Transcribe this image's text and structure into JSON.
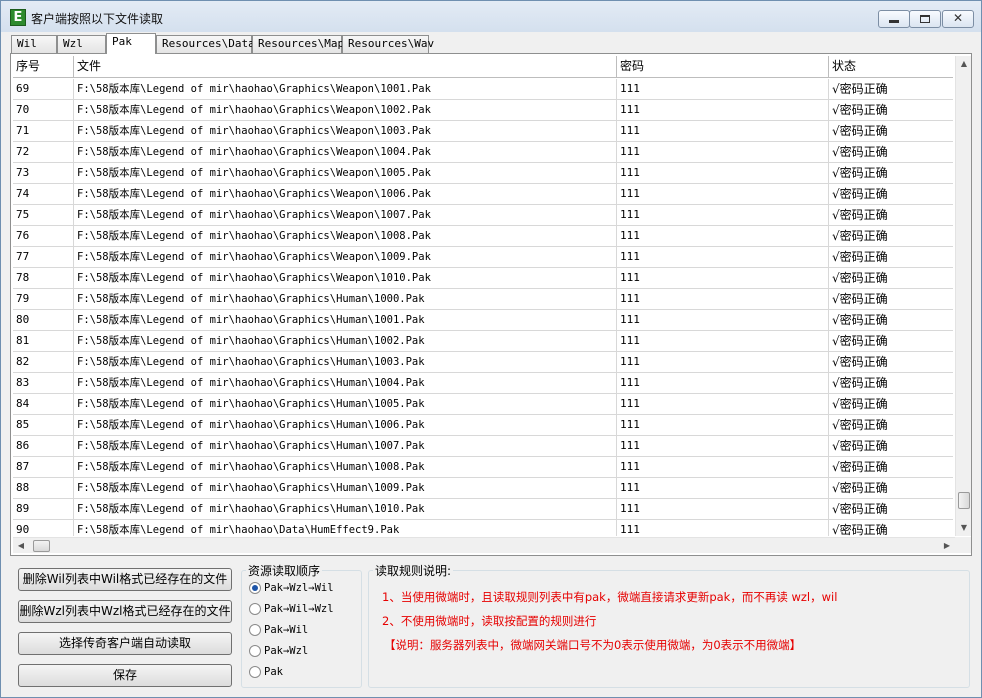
{
  "window": {
    "title": "客户端按照以下文件读取",
    "app_icon_letter": "E"
  },
  "tabs": [
    {
      "label": "Wil",
      "active": false
    },
    {
      "label": "Wzl",
      "active": false
    },
    {
      "label": "Pak",
      "active": true
    },
    {
      "label": "Resources\\Data",
      "active": false
    },
    {
      "label": "Resources\\Map",
      "active": false
    },
    {
      "label": "Resources\\Wav",
      "active": false
    }
  ],
  "table": {
    "columns": [
      "序号",
      "文件",
      "密码",
      "状态"
    ],
    "rows": [
      [
        "69",
        "F:\\58版本库\\Legend of mir\\haohao\\Graphics\\Weapon\\1001.Pak",
        "111",
        "√密码正确"
      ],
      [
        "70",
        "F:\\58版本库\\Legend of mir\\haohao\\Graphics\\Weapon\\1002.Pak",
        "111",
        "√密码正确"
      ],
      [
        "71",
        "F:\\58版本库\\Legend of mir\\haohao\\Graphics\\Weapon\\1003.Pak",
        "111",
        "√密码正确"
      ],
      [
        "72",
        "F:\\58版本库\\Legend of mir\\haohao\\Graphics\\Weapon\\1004.Pak",
        "111",
        "√密码正确"
      ],
      [
        "73",
        "F:\\58版本库\\Legend of mir\\haohao\\Graphics\\Weapon\\1005.Pak",
        "111",
        "√密码正确"
      ],
      [
        "74",
        "F:\\58版本库\\Legend of mir\\haohao\\Graphics\\Weapon\\1006.Pak",
        "111",
        "√密码正确"
      ],
      [
        "75",
        "F:\\58版本库\\Legend of mir\\haohao\\Graphics\\Weapon\\1007.Pak",
        "111",
        "√密码正确"
      ],
      [
        "76",
        "F:\\58版本库\\Legend of mir\\haohao\\Graphics\\Weapon\\1008.Pak",
        "111",
        "√密码正确"
      ],
      [
        "77",
        "F:\\58版本库\\Legend of mir\\haohao\\Graphics\\Weapon\\1009.Pak",
        "111",
        "√密码正确"
      ],
      [
        "78",
        "F:\\58版本库\\Legend of mir\\haohao\\Graphics\\Weapon\\1010.Pak",
        "111",
        "√密码正确"
      ],
      [
        "79",
        "F:\\58版本库\\Legend of mir\\haohao\\Graphics\\Human\\1000.Pak",
        "111",
        "√密码正确"
      ],
      [
        "80",
        "F:\\58版本库\\Legend of mir\\haohao\\Graphics\\Human\\1001.Pak",
        "111",
        "√密码正确"
      ],
      [
        "81",
        "F:\\58版本库\\Legend of mir\\haohao\\Graphics\\Human\\1002.Pak",
        "111",
        "√密码正确"
      ],
      [
        "82",
        "F:\\58版本库\\Legend of mir\\haohao\\Graphics\\Human\\1003.Pak",
        "111",
        "√密码正确"
      ],
      [
        "83",
        "F:\\58版本库\\Legend of mir\\haohao\\Graphics\\Human\\1004.Pak",
        "111",
        "√密码正确"
      ],
      [
        "84",
        "F:\\58版本库\\Legend of mir\\haohao\\Graphics\\Human\\1005.Pak",
        "111",
        "√密码正确"
      ],
      [
        "85",
        "F:\\58版本库\\Legend of mir\\haohao\\Graphics\\Human\\1006.Pak",
        "111",
        "√密码正确"
      ],
      [
        "86",
        "F:\\58版本库\\Legend of mir\\haohao\\Graphics\\Human\\1007.Pak",
        "111",
        "√密码正确"
      ],
      [
        "87",
        "F:\\58版本库\\Legend of mir\\haohao\\Graphics\\Human\\1008.Pak",
        "111",
        "√密码正确"
      ],
      [
        "88",
        "F:\\58版本库\\Legend of mir\\haohao\\Graphics\\Human\\1009.Pak",
        "111",
        "√密码正确"
      ],
      [
        "89",
        "F:\\58版本库\\Legend of mir\\haohao\\Graphics\\Human\\1010.Pak",
        "111",
        "√密码正确"
      ],
      [
        "90",
        "F:\\58版本库\\Legend of mir\\haohao\\Data\\HumEffect9.Pak",
        "111",
        "√密码正确"
      ]
    ]
  },
  "buttons": {
    "delete_wil": "删除Wil列表中Wil格式已经存在的文件",
    "delete_wzl": "删除Wzl列表中Wzl格式已经存在的文件",
    "auto_read": "选择传奇客户端自动读取",
    "save": "保存"
  },
  "read_order": {
    "title": "资源读取顺序",
    "options": [
      {
        "label": "Pak→Wzl→Wil",
        "checked": true
      },
      {
        "label": "Pak→Wil→Wzl",
        "checked": false
      },
      {
        "label": "Pak→Wil",
        "checked": false
      },
      {
        "label": "Pak→Wzl",
        "checked": false
      },
      {
        "label": "Pak",
        "checked": false
      }
    ]
  },
  "rules": {
    "title": "读取规则说明:",
    "lines": [
      "1、当使用微端时，且读取规则列表中有pak，微端直接请求更新pak，而不再读 wzl，wil",
      "2、不使用微端时，读取按配置的规则进行",
      "【说明：服务器列表中，微端网关端口号不为0表示使用微端，为0表示不用微端】"
    ],
    "color": "#e60000"
  }
}
